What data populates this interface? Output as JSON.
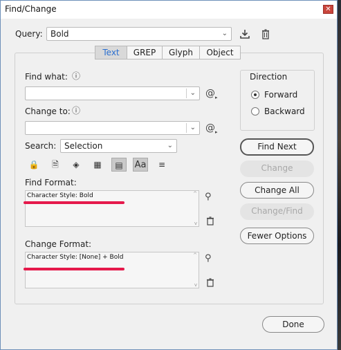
{
  "window": {
    "title": "Find/Change",
    "close_glyph": "✕"
  },
  "query": {
    "label": "Query:",
    "value": "Bold",
    "save_icon": "save-query-icon",
    "delete_icon": "trash-icon"
  },
  "tabs": [
    {
      "label": "Text",
      "active": true
    },
    {
      "label": "GREP",
      "active": false
    },
    {
      "label": "Glyph",
      "active": false
    },
    {
      "label": "Object",
      "active": false
    }
  ],
  "find_what": {
    "label": "Find what:",
    "value": "",
    "special_chars_icon": "at-symbol-icon"
  },
  "change_to": {
    "label": "Change to:",
    "value": "",
    "special_chars_icon": "at-symbol-icon"
  },
  "search": {
    "label": "Search:",
    "value": "Selection"
  },
  "options_toolbar": [
    {
      "icon": "include-locked-layers-icon",
      "glyph": "🔒",
      "selected": false
    },
    {
      "icon": "include-locked-stories-icon",
      "glyph": "🗎",
      "selected": false
    },
    {
      "icon": "include-hidden-layers-icon",
      "glyph": "◈",
      "selected": false
    },
    {
      "icon": "include-master-pages-icon",
      "glyph": "▦",
      "selected": false
    },
    {
      "icon": "include-footnotes-icon",
      "glyph": "▤",
      "selected": true
    },
    {
      "icon": "case-sensitive-icon",
      "glyph": "Aa",
      "selected": true
    },
    {
      "icon": "whole-word-icon",
      "glyph": "≡",
      "selected": false
    }
  ],
  "find_format": {
    "label": "Find Format:",
    "value": "Character Style: Bold"
  },
  "change_format": {
    "label": "Change Format:",
    "value": "Character Style: [None] + Bold"
  },
  "direction": {
    "label": "Direction",
    "options": [
      {
        "label": "Forward",
        "checked": true
      },
      {
        "label": "Backward",
        "checked": false
      }
    ]
  },
  "buttons": {
    "find_next": "Find Next",
    "change": "Change",
    "change_all": "Change All",
    "change_find": "Change/Find",
    "fewer_options": "Fewer Options",
    "done": "Done"
  },
  "colors": {
    "accent_tab": "#2a6fd0",
    "highlight_line": "#e5194b"
  }
}
